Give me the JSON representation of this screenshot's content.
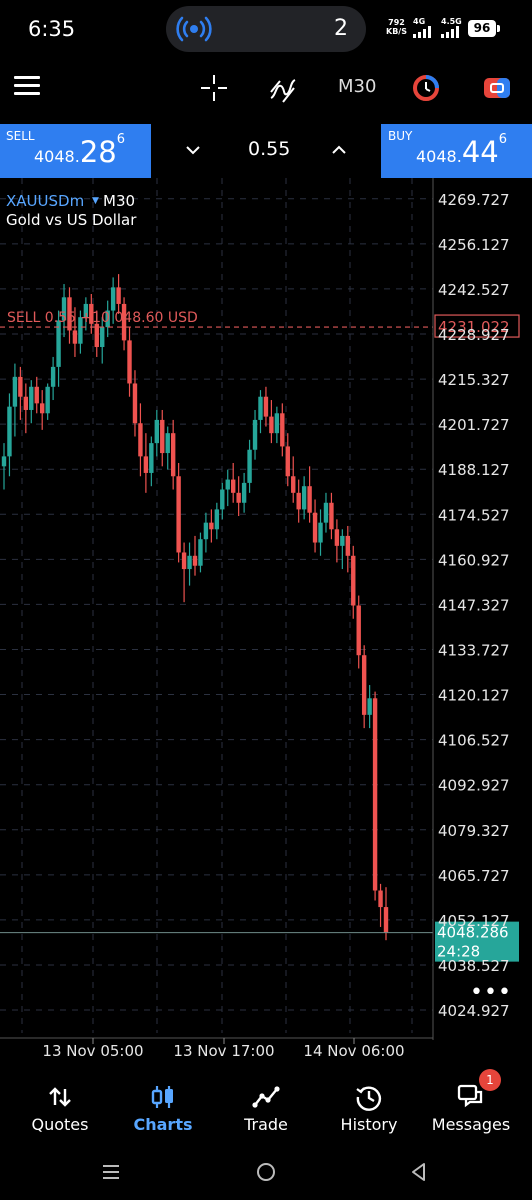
{
  "status_bar": {
    "time": "6:35",
    "live_count": "2",
    "net_speed_value": "792",
    "net_speed_unit": "KB/S",
    "net_1": "4G",
    "net_2": "4.5G",
    "battery": "96"
  },
  "toolbar": {
    "timeframe": "M30",
    "icons": [
      "menu-icon",
      "crosshair-icon",
      "indicator-icon",
      "clock-icon",
      "chart-type-icon"
    ]
  },
  "trade_panel": {
    "sell": {
      "label": "SELL",
      "price_small": "4048.",
      "price_big": "28",
      "price_sup": "6"
    },
    "buy": {
      "label": "BUY",
      "price_small": "4048.",
      "price_big": "44",
      "price_sup": "6"
    },
    "lot": "0.55"
  },
  "chart": {
    "symbol": "XAUUSDm",
    "timeframe": "M30",
    "description": "Gold vs US Dollar",
    "position_line": {
      "text": "SELL 0.55 +10 048.60 USD",
      "price_label": "4231.022",
      "color": "#e05a5a"
    },
    "bid_label": {
      "price": "4048.286",
      "countdown": "24:28",
      "color": "#26a69a"
    },
    "price_axis": [
      "4269.727",
      "4256.127",
      "4242.527",
      "4228.927",
      "4215.327",
      "4201.727",
      "4188.127",
      "4174.527",
      "4160.927",
      "4147.327",
      "4133.727",
      "4120.127",
      "4106.527",
      "4092.927",
      "4079.327",
      "4065.727",
      "4052.127",
      "4038.527",
      "4024.927"
    ],
    "time_axis": [
      "13 Nov 05:00",
      "13 Nov 17:00",
      "14 Nov 06:00"
    ],
    "bull_color": "#26a69a",
    "bear_color": "#ef5350"
  },
  "chart_data": {
    "type": "candlestick",
    "symbol": "XAUUSDm",
    "timeframe": "M30",
    "ylim": [
      4018.0,
      4276.0
    ],
    "x_ticks": [
      "13 Nov 05:00",
      "13 Nov 17:00",
      "14 Nov 06:00"
    ],
    "candles": [
      {
        "o": 4189,
        "h": 4196,
        "l": 4182,
        "c": 4192
      },
      {
        "o": 4192,
        "h": 4211,
        "l": 4186,
        "c": 4207
      },
      {
        "o": 4207,
        "h": 4220,
        "l": 4198,
        "c": 4216
      },
      {
        "o": 4216,
        "h": 4219,
        "l": 4203,
        "c": 4210
      },
      {
        "o": 4210,
        "h": 4214,
        "l": 4199,
        "c": 4206
      },
      {
        "o": 4206,
        "h": 4215,
        "l": 4202,
        "c": 4213
      },
      {
        "o": 4213,
        "h": 4216,
        "l": 4205,
        "c": 4208
      },
      {
        "o": 4208,
        "h": 4212,
        "l": 4200,
        "c": 4205
      },
      {
        "o": 4205,
        "h": 4214,
        "l": 4203,
        "c": 4213
      },
      {
        "o": 4213,
        "h": 4222,
        "l": 4209,
        "c": 4219
      },
      {
        "o": 4219,
        "h": 4236,
        "l": 4213,
        "c": 4233
      },
      {
        "o": 4233,
        "h": 4244,
        "l": 4228,
        "c": 4240
      },
      {
        "o": 4240,
        "h": 4243,
        "l": 4226,
        "c": 4230
      },
      {
        "o": 4230,
        "h": 4237,
        "l": 4222,
        "c": 4226
      },
      {
        "o": 4226,
        "h": 4236,
        "l": 4223,
        "c": 4234
      },
      {
        "o": 4234,
        "h": 4240,
        "l": 4230,
        "c": 4238
      },
      {
        "o": 4238,
        "h": 4241,
        "l": 4229,
        "c": 4232
      },
      {
        "o": 4232,
        "h": 4236,
        "l": 4222,
        "c": 4225
      },
      {
        "o": 4225,
        "h": 4234,
        "l": 4220,
        "c": 4231
      },
      {
        "o": 4231,
        "h": 4239,
        "l": 4228,
        "c": 4236
      },
      {
        "o": 4236,
        "h": 4246,
        "l": 4232,
        "c": 4243
      },
      {
        "o": 4243,
        "h": 4247,
        "l": 4235,
        "c": 4238
      },
      {
        "o": 4238,
        "h": 4240,
        "l": 4224,
        "c": 4227
      },
      {
        "o": 4227,
        "h": 4231,
        "l": 4210,
        "c": 4214
      },
      {
        "o": 4214,
        "h": 4218,
        "l": 4198,
        "c": 4202
      },
      {
        "o": 4202,
        "h": 4208,
        "l": 4186,
        "c": 4192
      },
      {
        "o": 4192,
        "h": 4199,
        "l": 4181,
        "c": 4187
      },
      {
        "o": 4187,
        "h": 4198,
        "l": 4183,
        "c": 4196
      },
      {
        "o": 4196,
        "h": 4206,
        "l": 4192,
        "c": 4203
      },
      {
        "o": 4203,
        "h": 4206,
        "l": 4189,
        "c": 4193
      },
      {
        "o": 4193,
        "h": 4201,
        "l": 4188,
        "c": 4199
      },
      {
        "o": 4199,
        "h": 4203,
        "l": 4182,
        "c": 4186
      },
      {
        "o": 4186,
        "h": 4190,
        "l": 4160,
        "c": 4163
      },
      {
        "o": 4163,
        "h": 4166,
        "l": 4148,
        "c": 4158
      },
      {
        "o": 4158,
        "h": 4166,
        "l": 4153,
        "c": 4162
      },
      {
        "o": 4162,
        "h": 4168,
        "l": 4156,
        "c": 4159
      },
      {
        "o": 4159,
        "h": 4169,
        "l": 4157,
        "c": 4167
      },
      {
        "o": 4167,
        "h": 4175,
        "l": 4163,
        "c": 4172
      },
      {
        "o": 4172,
        "h": 4176,
        "l": 4166,
        "c": 4170
      },
      {
        "o": 4170,
        "h": 4178,
        "l": 4167,
        "c": 4176
      },
      {
        "o": 4176,
        "h": 4184,
        "l": 4173,
        "c": 4182
      },
      {
        "o": 4182,
        "h": 4188,
        "l": 4177,
        "c": 4185
      },
      {
        "o": 4185,
        "h": 4190,
        "l": 4178,
        "c": 4181
      },
      {
        "o": 4181,
        "h": 4186,
        "l": 4174,
        "c": 4178
      },
      {
        "o": 4178,
        "h": 4187,
        "l": 4175,
        "c": 4184
      },
      {
        "o": 4184,
        "h": 4197,
        "l": 4181,
        "c": 4194
      },
      {
        "o": 4194,
        "h": 4206,
        "l": 4191,
        "c": 4203
      },
      {
        "o": 4203,
        "h": 4212,
        "l": 4199,
        "c": 4210
      },
      {
        "o": 4210,
        "h": 4213,
        "l": 4201,
        "c": 4204
      },
      {
        "o": 4204,
        "h": 4209,
        "l": 4196,
        "c": 4199
      },
      {
        "o": 4199,
        "h": 4207,
        "l": 4196,
        "c": 4205
      },
      {
        "o": 4205,
        "h": 4208,
        "l": 4192,
        "c": 4195
      },
      {
        "o": 4195,
        "h": 4199,
        "l": 4183,
        "c": 4186
      },
      {
        "o": 4186,
        "h": 4192,
        "l": 4178,
        "c": 4181
      },
      {
        "o": 4181,
        "h": 4185,
        "l": 4172,
        "c": 4176
      },
      {
        "o": 4176,
        "h": 4186,
        "l": 4173,
        "c": 4183
      },
      {
        "o": 4183,
        "h": 4189,
        "l": 4172,
        "c": 4175
      },
      {
        "o": 4175,
        "h": 4179,
        "l": 4163,
        "c": 4166
      },
      {
        "o": 4166,
        "h": 4176,
        "l": 4162,
        "c": 4172
      },
      {
        "o": 4172,
        "h": 4181,
        "l": 4169,
        "c": 4178
      },
      {
        "o": 4178,
        "h": 4181,
        "l": 4167,
        "c": 4170
      },
      {
        "o": 4170,
        "h": 4173,
        "l": 4160,
        "c": 4165
      },
      {
        "o": 4165,
        "h": 4170,
        "l": 4158,
        "c": 4168
      },
      {
        "o": 4168,
        "h": 4171,
        "l": 4157,
        "c": 4162
      },
      {
        "o": 4162,
        "h": 4165,
        "l": 4143,
        "c": 4147
      },
      {
        "o": 4147,
        "h": 4150,
        "l": 4128,
        "c": 4132
      },
      {
        "o": 4132,
        "h": 4135,
        "l": 4110,
        "c": 4114
      },
      {
        "o": 4114,
        "h": 4123,
        "l": 4110,
        "c": 4119
      },
      {
        "o": 4119,
        "h": 4121,
        "l": 4058,
        "c": 4061
      },
      {
        "o": 4061,
        "h": 4063,
        "l": 4050,
        "c": 4056
      },
      {
        "o": 4056,
        "h": 4062,
        "l": 4046,
        "c": 4048.286
      }
    ]
  },
  "bottom_nav": [
    {
      "label": "Quotes",
      "icon": "quotes-icon",
      "active": false
    },
    {
      "label": "Charts",
      "icon": "charts-icon",
      "active": true
    },
    {
      "label": "Trade",
      "icon": "trade-icon",
      "active": false
    },
    {
      "label": "History",
      "icon": "history-icon",
      "active": false
    },
    {
      "label": "Messages",
      "icon": "messages-icon",
      "active": false,
      "badge": "1"
    }
  ],
  "system_nav": [
    "recents-icon",
    "home-icon",
    "back-icon"
  ]
}
